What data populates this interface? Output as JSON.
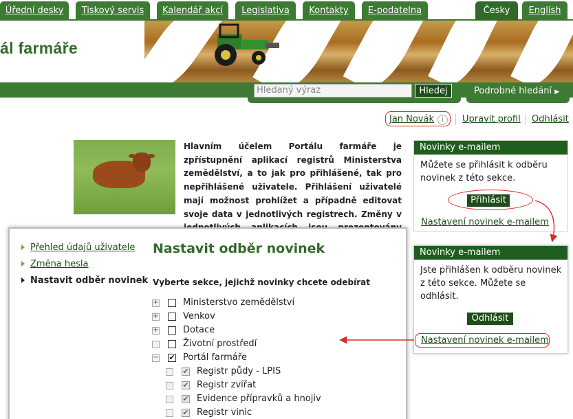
{
  "topnav": {
    "tabs": [
      {
        "label": "Úřední desky"
      },
      {
        "label": "Tiskový servis"
      },
      {
        "label": "Kalendář akcí"
      },
      {
        "label": "Legislativa"
      },
      {
        "label": "Kontakty"
      },
      {
        "label": "E-podatelna"
      }
    ],
    "languages": [
      {
        "label": "Česky",
        "active": true
      },
      {
        "label": "English",
        "active": false
      }
    ]
  },
  "banner": {
    "site_title": "ál farmáře"
  },
  "search": {
    "placeholder": "Hledaný výraz",
    "button_label": "Hledej",
    "advanced_label": "Podrobné hledání",
    "advanced_icon": "chevron-right-icon"
  },
  "user": {
    "name": "Jan Novák",
    "info_icon": "i",
    "edit_profile": "Upravit profil",
    "logout": "Odhlásit"
  },
  "intro": {
    "text": "Hlavním účelem Portálu farmáře je zpřístupnění aplikací registrů Ministerstva zemědělství, a to jak pro přihlášené, tak pro nepřihlášené uživatele. Přihlášení uživatelé mají možnost prohlížet a případně editovat svoje data v jednotlivých registrech. Změny v jednotlivých aplikacích jsou prezentovány formou novinek."
  },
  "widget_top": {
    "title": "Novinky e-mailem",
    "text": "Můžete se přihlásit k odběru novinek z této sekce.",
    "button": "Přihlásit",
    "link": "Nastavení novinek e-mailem"
  },
  "widget_bottom": {
    "title": "Novinky e-mailem",
    "text": "Jste přihlášen k odběru novinek z této sekce. Můžete se odhlásit.",
    "button": "Odhlásit",
    "link": "Nastavení novinek e-mailem"
  },
  "panel": {
    "sidebar": [
      {
        "label": "Přehled údajů uživatele",
        "active": false
      },
      {
        "label": "Změna hesla",
        "active": false
      },
      {
        "label": "Nastavit odběr novinek",
        "active": true
      }
    ],
    "title": "Nastavit odběr novinek",
    "subtitle": "Vyberte sekce, jejichž novinky chcete odebírat",
    "tree": [
      {
        "label": "Ministerstvo zemědělství",
        "expander": "+",
        "checked": false,
        "level": 0
      },
      {
        "label": "Venkov",
        "expander": "+",
        "checked": false,
        "level": 0
      },
      {
        "label": "Dotace",
        "expander": "+",
        "checked": false,
        "level": 0
      },
      {
        "label": "Životní prostředí",
        "expander": "",
        "checked": false,
        "level": 0
      },
      {
        "label": "Portál farmáře",
        "expander": "−",
        "checked": true,
        "level": 0
      },
      {
        "label": "Registr půdy - LPIS",
        "expander": "",
        "checked": true,
        "level": 1
      },
      {
        "label": "Registr zvířat",
        "expander": "",
        "checked": true,
        "level": 1
      },
      {
        "label": "Evidence přípravků a hnojiv",
        "expander": "",
        "checked": true,
        "level": 1
      },
      {
        "label": "Registr vinic",
        "expander": "",
        "checked": true,
        "level": 1
      }
    ]
  },
  "colors": {
    "brand_green": "#3d7a33",
    "dark_green": "#1f5e1f",
    "annotation_red": "#d52b2b"
  }
}
